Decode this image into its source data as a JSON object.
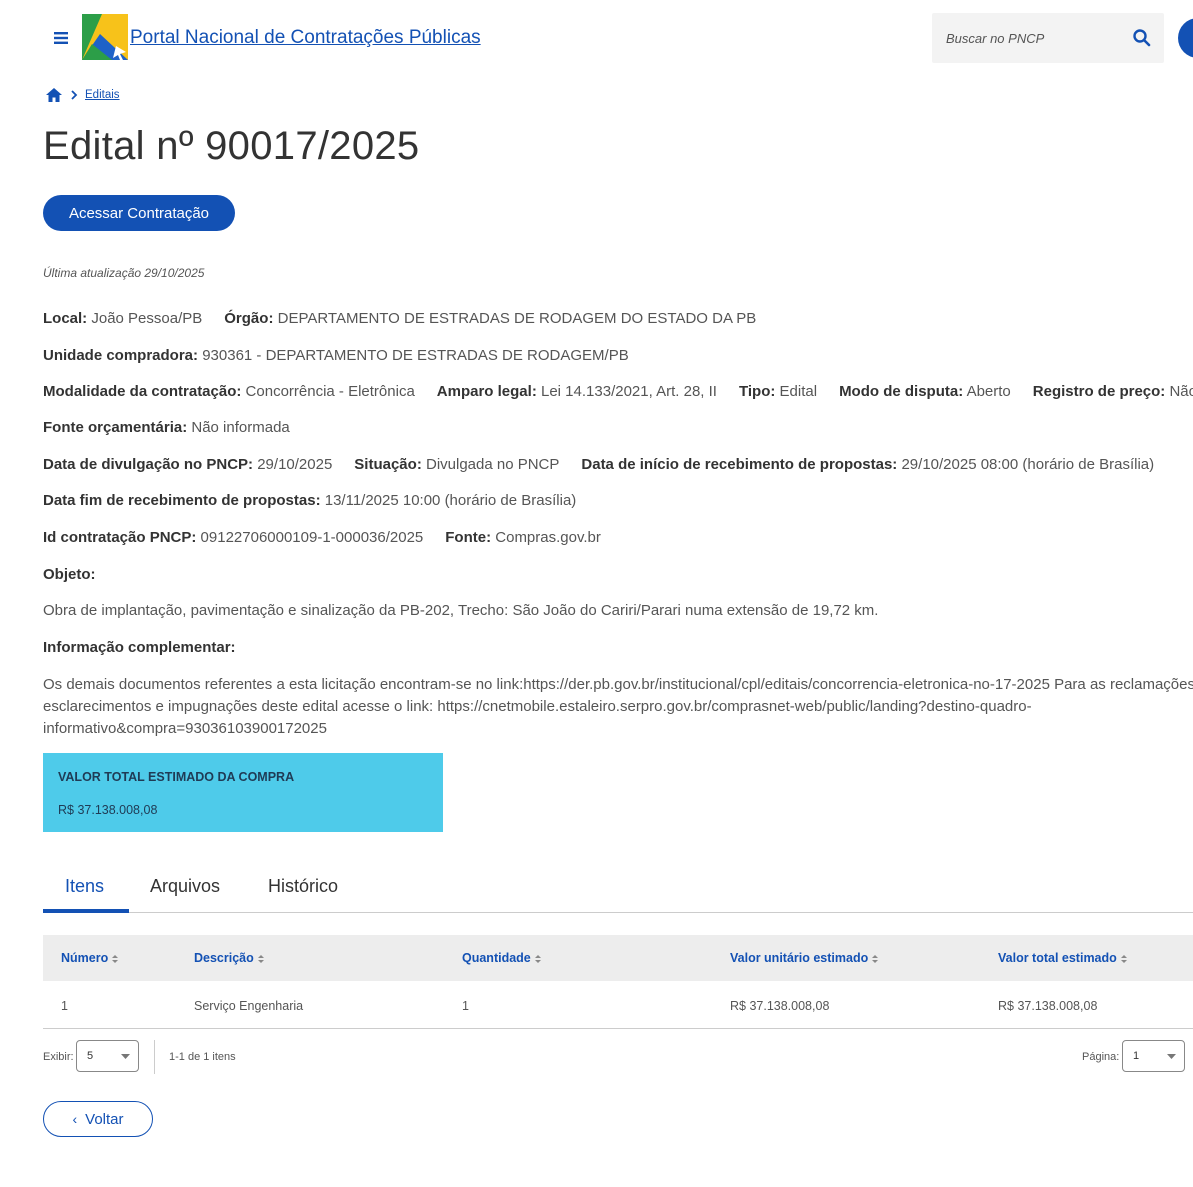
{
  "header": {
    "portal_title": "Portal Nacional de Contratações Públicas",
    "search_placeholder": "Buscar no PNCP"
  },
  "breadcrumb": {
    "current": "Editais"
  },
  "page_title": "Edital nº 90017/2025",
  "access_button": "Acessar Contratação",
  "last_update": "Última atualização 29/10/2025",
  "info": {
    "local_label": "Local:",
    "local_value": "João Pessoa/PB",
    "orgao_label": "Órgão:",
    "orgao_value": "DEPARTAMENTO DE ESTRADAS DE RODAGEM DO ESTADO DA PB",
    "unidade_label": "Unidade compradora:",
    "unidade_value": "930361 - DEPARTAMENTO DE ESTRADAS DE RODAGEM/PB",
    "modalidade_label": "Modalidade da contratação:",
    "modalidade_value": "Concorrência - Eletrônica",
    "amparo_label": "Amparo legal:",
    "amparo_value": "Lei 14.133/2021, Art. 28, II",
    "tipo_label": "Tipo:",
    "tipo_value": "Edital",
    "modo_label": "Modo de disputa:",
    "modo_value": "Aberto",
    "registro_label": "Registro de preço:",
    "registro_value": "Não",
    "fonte_orc_label": "Fonte orçamentária:",
    "fonte_orc_value": "Não informada",
    "divulgacao_label": "Data de divulgação no PNCP:",
    "divulgacao_value": "29/10/2025",
    "situacao_label": "Situação:",
    "situacao_value": "Divulgada no PNCP",
    "inicio_label": "Data de início de recebimento de propostas:",
    "inicio_value": "29/10/2025 08:00 (horário de Brasília)",
    "fim_label": "Data fim de recebimento de propostas:",
    "fim_value": "13/11/2025 10:00 (horário de Brasília)",
    "id_label": "Id contratação PNCP:",
    "id_value": "09122706000109-1-000036/2025",
    "fonte_label": "Fonte:",
    "fonte_value": "Compras.gov.br",
    "objeto_label": "Objeto:",
    "objeto_value": "Obra de implantação, pavimentação e sinalização da PB-202, Trecho: São João do Cariri/Parari numa extensão de 19,72 km.",
    "compl_label": "Informação complementar:",
    "compl_line1": "Os demais documentos referentes a esta licitação encontram-se no link:https://der.pb.gov.br/institucional/cpl/editais/concorrencia-eletronica-no-17-2025 Para as reclamações,",
    "compl_line2": "esclarecimentos e impugnações deste edital acesse o link: https://cnetmobile.estaleiro.serpro.gov.br/comprasnet-web/public/landing?destino-quadro-",
    "compl_line3": "informativo&compra=93036103900172025"
  },
  "value_box": {
    "label": "VALOR TOTAL ESTIMADO DA COMPRA",
    "amount": "R$ 37.138.008,08"
  },
  "tabs": [
    "Itens",
    "Arquivos",
    "Histórico"
  ],
  "table": {
    "headers": [
      "Número",
      "Descrição",
      "Quantidade",
      "Valor unitário estimado",
      "Valor total estimado"
    ],
    "rows": [
      [
        "1",
        "Serviço Engenharia",
        "1",
        "R$ 37.138.008,08",
        "R$ 37.138.008,08"
      ]
    ]
  },
  "pagination": {
    "show_label": "Exibir:",
    "show_value": "5",
    "range_text": "1-1 de 1 itens",
    "page_label": "Página:",
    "page_value": "1"
  },
  "back_button": "Voltar",
  "colors": {
    "primary": "#1351b4",
    "value_box": "#4ecbea"
  }
}
